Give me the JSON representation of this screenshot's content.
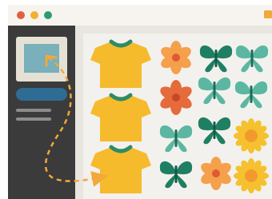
{
  "window": {
    "traffic_lights": [
      {
        "name": "close",
        "color": "#E0613F"
      },
      {
        "name": "minimize",
        "color": "#EEB32E"
      },
      {
        "name": "maximize",
        "color": "#2E9C72"
      }
    ],
    "corner_badge_color": "#F2A83B"
  },
  "sidebar": {
    "bg_color": "#3B3B3B",
    "thumbnail": {
      "frame_color": "#E6E1D5",
      "image_color": "#79B0BA"
    },
    "selected_item_color": "#2F6C93",
    "text_lines_color": "#8C8C8C"
  },
  "canvas": {
    "bg_color": "#F3F1EE",
    "tshirts": [
      {
        "body_color": "#F5BB2C",
        "collar_color": "#2E8C65"
      },
      {
        "body_color": "#F5BB2C",
        "collar_color": "#2E8C65"
      },
      {
        "body_color": "#F5BB2C",
        "collar_color": "#2E8C65"
      }
    ],
    "grid_icons": [
      [
        "flower-orange-icon",
        "butterfly-teal-icon",
        "butterfly-mint-icon"
      ],
      [
        "flower-red-icon",
        "butterfly-mint-icon",
        "butterfly-mint-icon"
      ],
      [
        "butterfly-mint-icon",
        "butterfly-teal-icon",
        "sunflower-icon"
      ],
      [
        "butterfly-teal-icon",
        "flower-orange-icon",
        "sunflower-icon"
      ]
    ]
  },
  "drag_path": {
    "color": "#F2A83B",
    "style": "dashed"
  }
}
